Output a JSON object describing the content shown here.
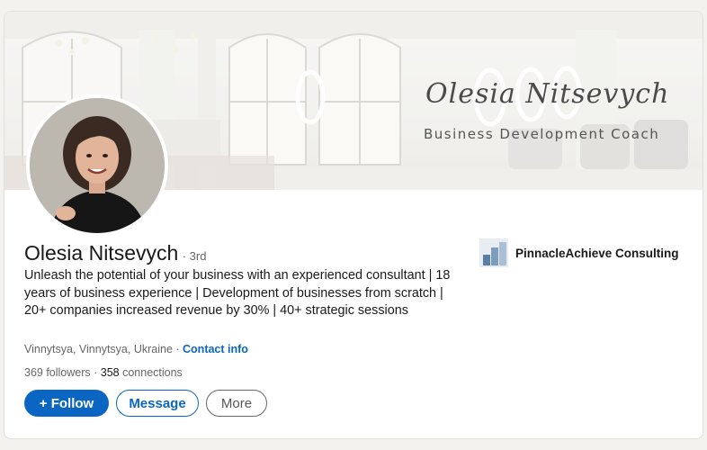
{
  "banner": {
    "script_name": "Olesia Nitsevych",
    "subtitle": "Business Development Coach"
  },
  "profile": {
    "name": "Olesia Nitsevych",
    "degree": "· 3rd",
    "headline": "Unleash the potential of your business with an experienced consultant | 18 years of business experience | Development of businesses from scratch | 20+ companies increased revenue by 30% | 40+ strategic sessions",
    "location": "Vinnytsya, Vinnytsya, Ukraine · ",
    "contact_info": "Contact info",
    "followers": "369 followers",
    "separator": " · ",
    "connections_count": "358",
    "connections_label": " connections"
  },
  "actions": {
    "follow": "+ Follow",
    "message": "Message",
    "more": "More"
  },
  "company": {
    "name": "PinnacleAchieve Consulting",
    "logo_icon": "building-logo-icon"
  },
  "colors": {
    "accent": "#0a66c2",
    "text": "#191919",
    "muted": "#666666"
  }
}
